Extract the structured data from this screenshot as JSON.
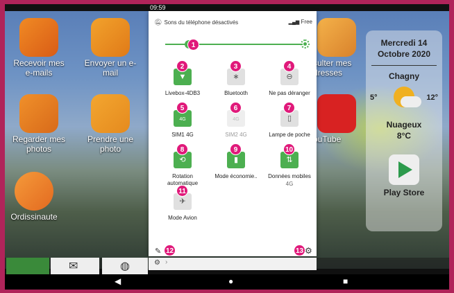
{
  "statusbar": {
    "time": "09:59"
  },
  "home": {
    "apps": [
      {
        "label": "Recevoir mes e-mails",
        "icon": "envelope-icon"
      },
      {
        "label": "Envoyer un e-mail",
        "icon": "send-mail-icon"
      },
      {
        "label": "Regarder mes photos",
        "icon": "photos-icon"
      },
      {
        "label": "Prendre une photo",
        "icon": "camera-icon"
      },
      {
        "label": "Ordissinaute",
        "icon": "ordissinaute-icon"
      },
      {
        "label": "sulter mes dresses",
        "icon": "address-book-icon"
      },
      {
        "label": "ouTube",
        "icon": "youtube-icon"
      }
    ],
    "widget": {
      "date_line1": "Mercredi 14",
      "date_line2": "Octobre 2020",
      "city": "Chagny",
      "temp_min": "5°",
      "temp_max": "12°",
      "condition": "Nuageux",
      "current_temp": "8°C",
      "play_store_label": "Play Store"
    }
  },
  "quick_settings": {
    "sound_status": "Sons du téléphone désactivés",
    "carrier": "Free",
    "brightness_level": 0.17,
    "tiles": [
      {
        "label": "Livebox-4DB3",
        "sub": "",
        "state": "on",
        "icon": "wifi-icon",
        "badge": "2"
      },
      {
        "label": "Bluetooth",
        "sub": "",
        "state": "off",
        "icon": "bluetooth-icon",
        "badge": "3"
      },
      {
        "label": "Ne pas déranger",
        "sub": "",
        "state": "off",
        "icon": "do-not-disturb-icon",
        "badge": "4"
      },
      {
        "label": "SIM1 4G",
        "sub": "",
        "state": "on",
        "icon": "sim-4g-icon",
        "glyph": "4G",
        "badge": "5"
      },
      {
        "label": "SIM2 4G",
        "sub": "",
        "state": "disabled",
        "icon": "sim-4g-icon",
        "glyph": "4G",
        "badge": "6"
      },
      {
        "label": "Lampe de poche",
        "sub": "",
        "state": "off",
        "icon": "flashlight-icon",
        "badge": "7"
      },
      {
        "label": "Rotation automatique",
        "sub": "",
        "state": "on",
        "icon": "rotation-icon",
        "badge": "8"
      },
      {
        "label": "Mode économie..",
        "sub": "",
        "state": "on",
        "icon": "battery-saver-icon",
        "badge": "9"
      },
      {
        "label": "Données mobiles",
        "sub": "4G",
        "state": "on",
        "icon": "mobile-data-icon",
        "badge": "10"
      },
      {
        "label": "Mode Avion",
        "sub": "",
        "state": "off",
        "icon": "airplane-icon",
        "badge": "11"
      }
    ],
    "badges": {
      "brightness": "1",
      "edit": "12",
      "settings": "13"
    }
  }
}
